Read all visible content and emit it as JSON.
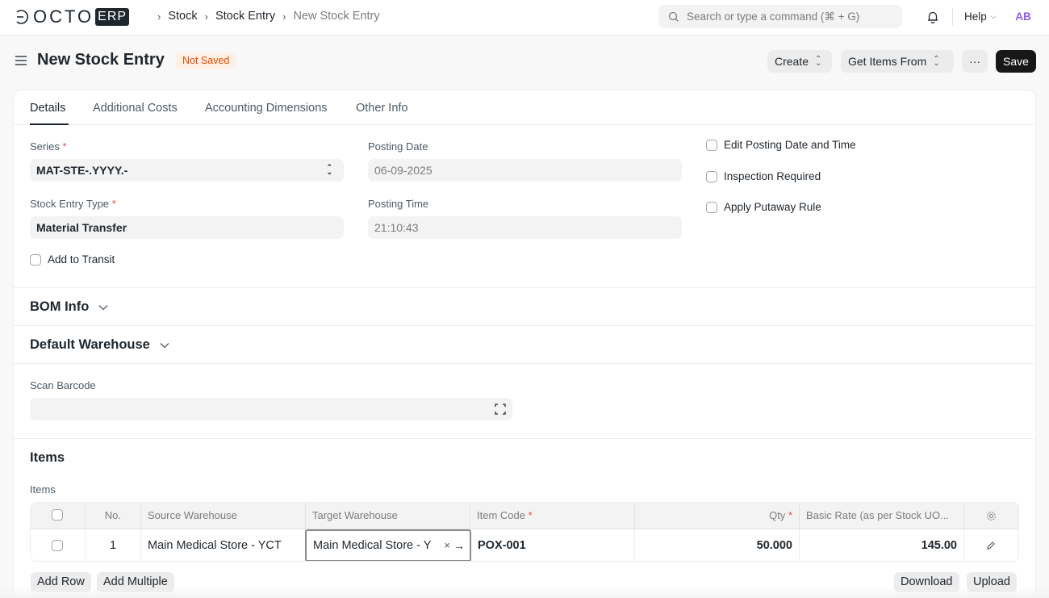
{
  "brand": {
    "logo_text": "OCTO",
    "logo_badge": "ERP"
  },
  "breadcrumb": {
    "items": [
      "Stock",
      "Stock Entry"
    ],
    "current": "New Stock Entry"
  },
  "search": {
    "placeholder": "Search or type a command (⌘ + G)"
  },
  "help": {
    "label": "Help"
  },
  "user": {
    "initials": "AB"
  },
  "page": {
    "title": "New Stock Entry",
    "status": "Not Saved"
  },
  "actions": {
    "create": "Create",
    "get_items_from": "Get Items From",
    "more": "···",
    "save": "Save"
  },
  "tabs": [
    {
      "label": "Details",
      "active": true
    },
    {
      "label": "Additional Costs"
    },
    {
      "label": "Accounting Dimensions"
    },
    {
      "label": "Other Info"
    }
  ],
  "form": {
    "series_label": "Series",
    "series_value": "MAT-STE-.YYYY.-",
    "stock_entry_type_label": "Stock Entry Type",
    "stock_entry_type_value": "Material Transfer",
    "add_to_transit": "Add to Transit",
    "posting_date_label": "Posting Date",
    "posting_date_value": "06-09-2025",
    "posting_time_label": "Posting Time",
    "posting_time_value": "21:10:43",
    "edit_posting": "Edit Posting Date and Time",
    "inspection_required": "Inspection Required",
    "apply_putaway": "Apply Putaway Rule"
  },
  "sections": {
    "bom_info": "BOM Info",
    "default_warehouse": "Default Warehouse",
    "scan_barcode_label": "Scan Barcode",
    "items_title": "Items",
    "items_label": "Items"
  },
  "items_table": {
    "columns": [
      "No.",
      "Source Warehouse",
      "Target Warehouse",
      "Item Code",
      "Qty",
      "Basic Rate (as per Stock UO..."
    ],
    "rows": [
      {
        "no": "1",
        "source": "Main Medical Store - YCT",
        "target": "Main Medical Store - Y",
        "item_code": "POX-001",
        "qty": "50.000",
        "rate": "145.00"
      }
    ]
  },
  "table_actions": {
    "add_row": "Add Row",
    "add_multiple": "Add Multiple",
    "download": "Download",
    "upload": "Upload"
  }
}
